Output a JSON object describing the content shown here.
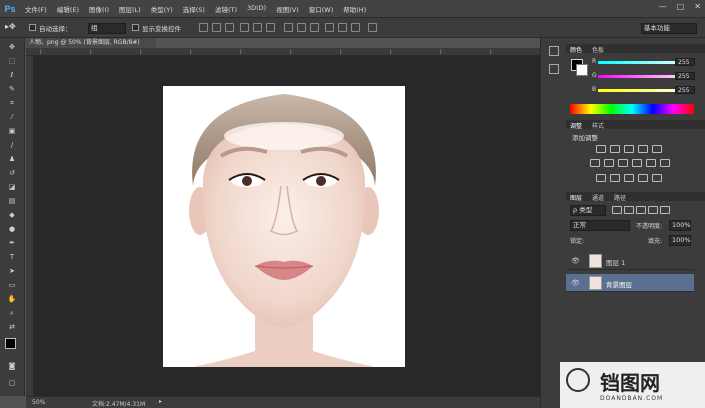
{
  "app": {
    "logo": "Ps"
  },
  "menu": [
    "文件(F)",
    "编辑(E)",
    "图像(I)",
    "图层(L)",
    "类型(Y)",
    "选择(S)",
    "滤镜(T)",
    "3D(D)",
    "视图(V)",
    "窗口(W)",
    "帮助(H)"
  ],
  "window_controls": [
    "—",
    "□",
    "✕"
  ],
  "options": {
    "auto_select_label": "自动选择：",
    "auto_select_value": "组",
    "transform_label": "显示变换控件",
    "workspace": "基本功能"
  },
  "document": {
    "tab_title": "人物。png @ 50% (背景图层, RGB/8#)",
    "zoom": "50%",
    "doc_size": "文档:2.47M/4.31M"
  },
  "color_panel": {
    "tabs": [
      "颜色",
      "色板"
    ],
    "r_label": "R",
    "g_label": "G",
    "b_label": "B",
    "r": "255",
    "g": "255",
    "b": "255"
  },
  "adjust_panel": {
    "tabs": [
      "调整",
      "样式"
    ],
    "title": "添加调整"
  },
  "layers_panel": {
    "tabs": [
      "图层",
      "通道",
      "路径"
    ],
    "filter_kind": "ρ 类型",
    "blend_mode": "正常",
    "opacity_label": "不透明度:",
    "opacity": "100%",
    "lock_label": "锁定:",
    "fill_label": "填充:",
    "fill": "100%",
    "layers": [
      {
        "name": "图层 1",
        "selected": false
      },
      {
        "name": "背景图层",
        "selected": true
      }
    ]
  },
  "watermark": {
    "text": "铛图网",
    "sub": "DOANDBAN.COM"
  },
  "colors": {
    "accent": "#4fb2f5",
    "selected_layer": "#5a7090"
  }
}
